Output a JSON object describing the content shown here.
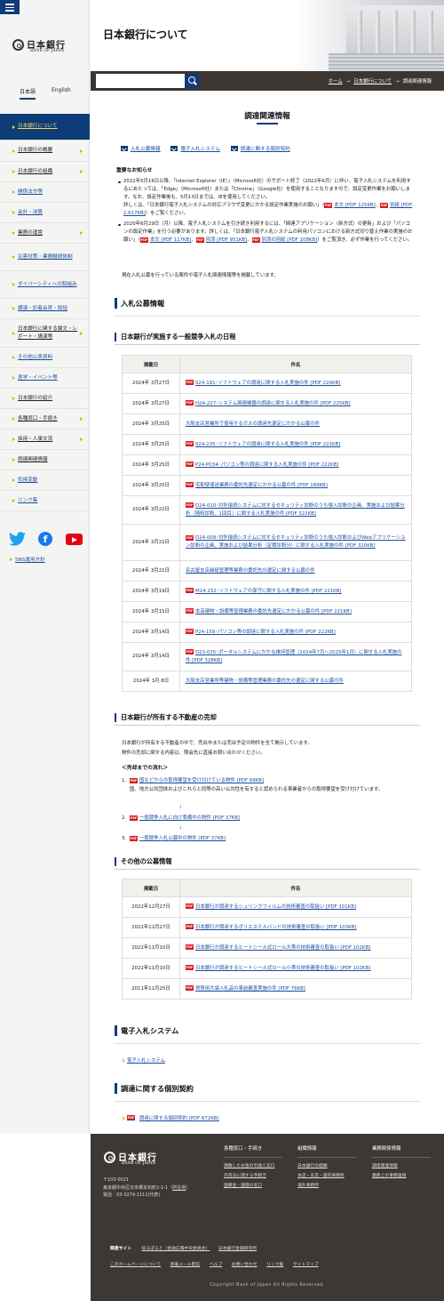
{
  "site": {
    "logo_jp": "日本銀行",
    "logo_en": "BANK OF JAPAN"
  },
  "lang": {
    "ja": "日本語",
    "en": "English"
  },
  "nav": [
    "日本銀行について",
    "日本銀行の概要",
    "日本銀行の組織",
    "関係法令等",
    "会計・決算",
    "業務の運営",
    "災害対策・業務継続体制",
    "ダイバーシティへの取組み",
    "講演・記者会見・談話",
    "日本銀行に関する論文・レポート・講演等",
    "その他公表資料",
    "見学・イベント等",
    "日本銀行の紹介",
    "各種窓口・手続き",
    "採用・人事交流",
    "調達関連情報",
    "気候変動",
    "リンク集"
  ],
  "social": {
    "twitter": "twitter-icon",
    "facebook": "f",
    "youtube": "youtube-icon",
    "policy": "SNS運用方針"
  },
  "header": {
    "title": "日本銀行について"
  },
  "search": {
    "placeholder": ""
  },
  "breadcrumb": [
    "ホーム",
    "日本銀行について",
    "調達関連情報"
  ],
  "page": {
    "title": "調達関連情報"
  },
  "anchors": [
    "入札公募情報",
    "電子入札システム",
    "調達に関する個別契約"
  ],
  "notice": {
    "title": "重要なお知らせ",
    "item1": {
      "text": "2022年5月16日以降、「Internet Explorer（IE）」（Microsoft社）のサポート終了（2022年6月）に伴い、電子入札システムを利用するにあたっては、「Edge」（Microsoft社）または「Chrome」（Google社）を使用することなりますので、設定変更作業をお願いします。なお、設定作業後も、5月13日までは、IEを使用してください。",
      "text2": "詳しくは、「日本銀行電子入札システムの対応ブラウザ変更にかかる設定作業実施のお願い」（",
      "link1": "本文 [PDF 125KB]",
      "link2": "別紙 [PDF 2,617KB]",
      "tail": "）をご覧ください。"
    },
    "item2": {
      "text": "2020年6月29日（月）以降、電子入札システムを引き続き利用するには、「関連アプリケーション（新方式）の更新」および「パソコンの設定作業」を行う必要があります。詳しくは、「日本銀行電子入札システムの利用パソコンにおける新方式切り替え作業の実施のお願い」（",
      "link1": "本文 [PDF 117KB]",
      "link2": "別添 [PDF 951KB]",
      "link3": "別添の別紙 [PDF 108KB]",
      "tail": "）をご覧頂き、必ず作業を行ってください。"
    }
  },
  "intro": "現在入札公募を行っている案件や電子入札関連情報等を掲載しています。",
  "sections": {
    "bidding": "入札公募情報",
    "schedule": "日本銀行が実施する一般競争入札の日程",
    "realestate": "日本銀行が所有する不動産の売却",
    "other": "その他の公募情報",
    "ebid": "電子入札システム",
    "contract": "調達に関する個別契約"
  },
  "table_headers": {
    "date": "掲載日",
    "subject": "件名"
  },
  "schedule_rows": [
    {
      "date": "2024年 3月27日",
      "pdf": true,
      "subject": "S24-191･ソフトウェアの調達に関する入札実施の件 [PDF 220KB]"
    },
    {
      "date": "2024年 3月27日",
      "pdf": true,
      "subject": "H24-227･システム関連機器の調達に関する入札実施の件 [PDF 225KB]"
    },
    {
      "date": "2024年 3月25日",
      "pdf": false,
      "subject": "大阪支店営業所で使用するガスの調達先選定にかかる公募の件"
    },
    {
      "date": "2024年 3月25日",
      "pdf": true,
      "subject": "S24-235･ソフトウェアの調達に関する入札実施の件 [PDF 222KB]"
    },
    {
      "date": "2024年 3月25日",
      "pdf": true,
      "subject": "P24-PC04･パソコン等の調達に関する入札実施の件 [PDF 222KB]"
    },
    {
      "date": "2024年 3月25日",
      "pdf": true,
      "subject": "宅配便運送業務の委託先選定にかかる公募の件 [PDF 189KB]"
    },
    {
      "date": "2024年 3月22日",
      "pdf": true,
      "subject": "D24-010･対外接続システムに対するセキュリティ診断のうち侵入診断の企画、実施および結果分析（随時診断、1回目）に関する入札実施の件 [PDF 322KB]"
    },
    {
      "date": "2024年 3月22日",
      "pdf": true,
      "subject": "D24-009･対外接続システムに対するセキュリティ診断のうち侵入診断およびWebアプリケーション診断の企画、実施および結果分析（定期診断分）に関する入札実施の件 [PDF 320KB]"
    },
    {
      "date": "2024年 3月21日",
      "pdf": false,
      "subject": "名古屋支店縁紐管理等業務の委託先の選定に関する公募の件"
    },
    {
      "date": "2024年 3月19日",
      "pdf": true,
      "subject": "M24-232･ソフトウェアの保守に関する入札実施の件 [PDF 221KB]"
    },
    {
      "date": "2024年 3月15日",
      "pdf": true,
      "subject": "本店建物・設備等管理業務の委託先選定にかかる公募の件 [PDF 221KB]"
    },
    {
      "date": "2024年 3月14日",
      "pdf": true,
      "subject": "P24-159･パソコン等の調達に関する入札実施の件 [PDF 222KB]"
    },
    {
      "date": "2024年 3月14日",
      "pdf": true,
      "subject": "D23-035･ポータルシステムにかかる維持管理（2024年7月～2025年1月）に関する入札実施の件 [PDF 328KB]"
    },
    {
      "date": "2024年 3月 8日",
      "pdf": false,
      "subject": "大阪支店営業所等建物・設備等管理業務の委託先の選定に関する公募の件"
    }
  ],
  "realestate": {
    "desc1": "日本銀行が所有する不動産の中で、売出中または売出予定の物件を全て掲示しています。",
    "desc2": "物件の売却に関する内容は、照会先に直接お問い合わせください。",
    "flow_title": "＜売却までの流れ＞",
    "step1": "国などからの取得要望を受け付けている物件 [PDF 69KB]",
    "step1_note": "国、地方公共団体およびこれらと同等の高い公共性を有すると認められる事業者からの取得要望を受け付けています。",
    "step2": "一般競争入札に向け準備中の物件 [PDF 37KB]",
    "step3": "一般競争入札公募中の物件 [PDF 37KB]",
    "arrow": "↓"
  },
  "other_rows": [
    {
      "date": "2022年12月27日",
      "subject": "日本銀行が調達するシュリンクフィルムの技術審査の取扱い [PDF 101KB]"
    },
    {
      "date": "2022年12月27日",
      "subject": "日本銀行が調達するポリエステルバンドの技術審査の取扱い [PDF 103KB]"
    },
    {
      "date": "2022年11月10日",
      "subject": "日本銀行が調達するヒートシール式ロール大帯の技術審査の取扱い [PDF 102KB]"
    },
    {
      "date": "2022年11月10日",
      "subject": "日本銀行が調達するヒートシール式ロール小帯の技術審査の取扱い [PDF 102KB]"
    },
    {
      "date": "2011年11月25日",
      "subject": "貨幣用大袋入札品の事前審査実施の件 [PDF 76KB]"
    }
  ],
  "ebid_link": "電子入札システム",
  "contract_link": "調達に関する個別契約 [PDF 672KB]",
  "footer": {
    "postal": "〒103-0021",
    "address": "東京都中央区日本橋本石町2-1-1",
    "map_link": "所在地",
    "phone": "電話　03-3279-1111(代表)",
    "col1": {
      "title": "各種窓口・手続き",
      "links": [
        "損傷したお金の引換え窓口",
        "外為法に関する手続き",
        "国庫金・国債の窓口"
      ]
    },
    "col2": {
      "title": "組織情報",
      "links": [
        "日本銀行の組織",
        "本店・支店・国内事務所",
        "海外事務所"
      ]
    },
    "col3": {
      "title": "業務関係情報",
      "links": [
        "調達関連情報",
        "業務上の事務連絡"
      ]
    },
    "related_label": "関連サイト",
    "related": [
      "知るぽると（金融広報中央委員会）",
      "日本銀行金融研究所"
    ],
    "bottom": [
      "このホームページについて",
      "新着メール配信",
      "ヘルプ",
      "お問い合わせ",
      "リンク集",
      "サイトマップ"
    ],
    "copyright": "Copyright Bank of Japan All Rights Reserved."
  },
  "colors": {
    "navy": "#0d3c78",
    "accent": "#e6a800",
    "footer": "#3c3835",
    "pdf": "#d61f1f"
  }
}
